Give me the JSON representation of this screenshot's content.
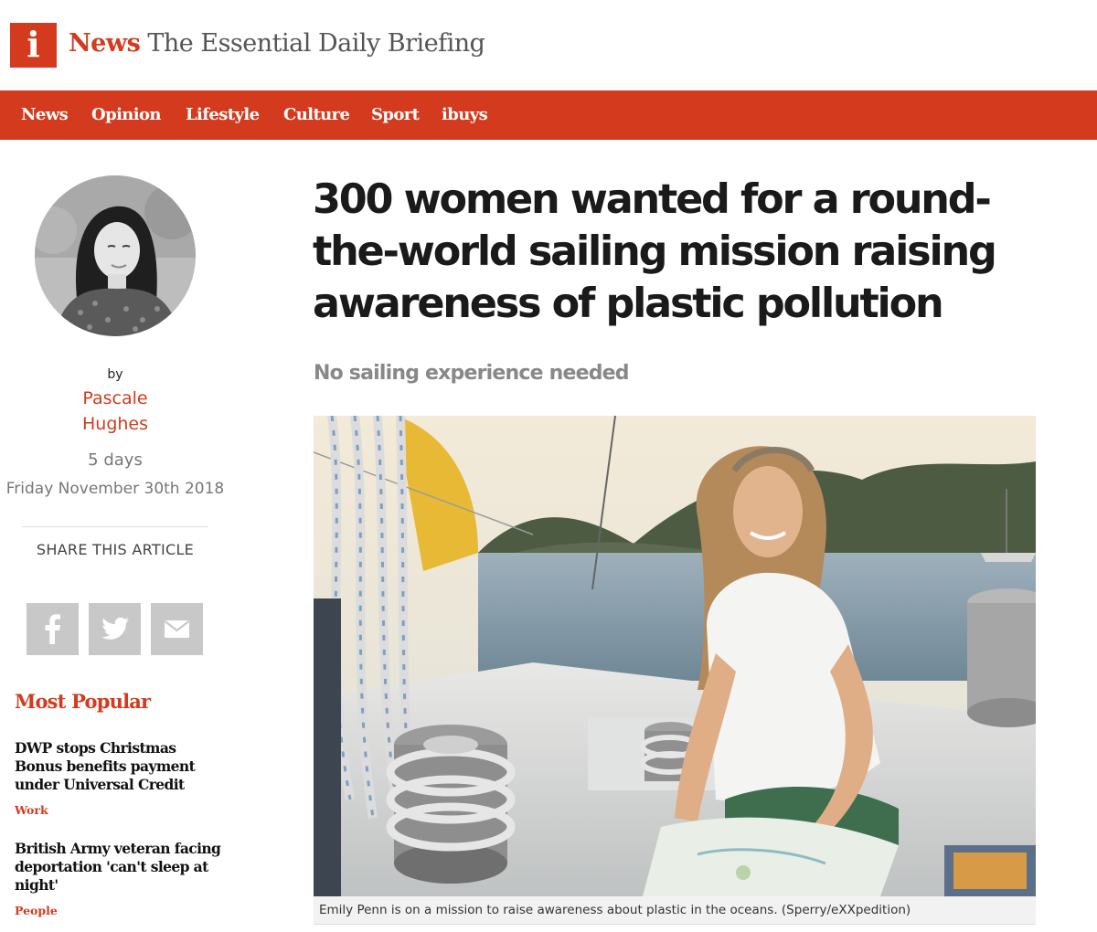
{
  "masthead": {
    "logo_letter": "i",
    "brand_name": "News",
    "tagline": "The Essential Daily Briefing"
  },
  "nav": {
    "items": [
      "News",
      "Opinion",
      "Lifestyle",
      "Culture",
      "Sport",
      "ibuys"
    ]
  },
  "author": {
    "by_label": "by",
    "name": "Pascale Hughes",
    "relative_date": "5 days",
    "date": "Friday November 30th 2018"
  },
  "share": {
    "label": "SHARE THIS ARTICLE",
    "icons": [
      "facebook-icon",
      "twitter-icon",
      "email-icon"
    ]
  },
  "most_popular": {
    "heading": "Most Popular",
    "items": [
      {
        "title": "DWP stops Christmas Bonus benefits payment under Universal Credit",
        "category": "Work"
      },
      {
        "title": "British Army veteran facing deportation 'can't sleep at night'",
        "category": "People"
      }
    ]
  },
  "article": {
    "headline": "300 women wanted for a round-the-world sailing mission raising awareness of plastic pollution",
    "standfirst": "No sailing experience needed",
    "image_caption": "Emily Penn is on a mission to raise awareness about plastic in the oceans. (Sperry/eXXpedition)"
  },
  "colors": {
    "brand_red": "#d43a1e",
    "share_button": "#c8c8c8",
    "caption_bg": "#f2f2f2"
  }
}
